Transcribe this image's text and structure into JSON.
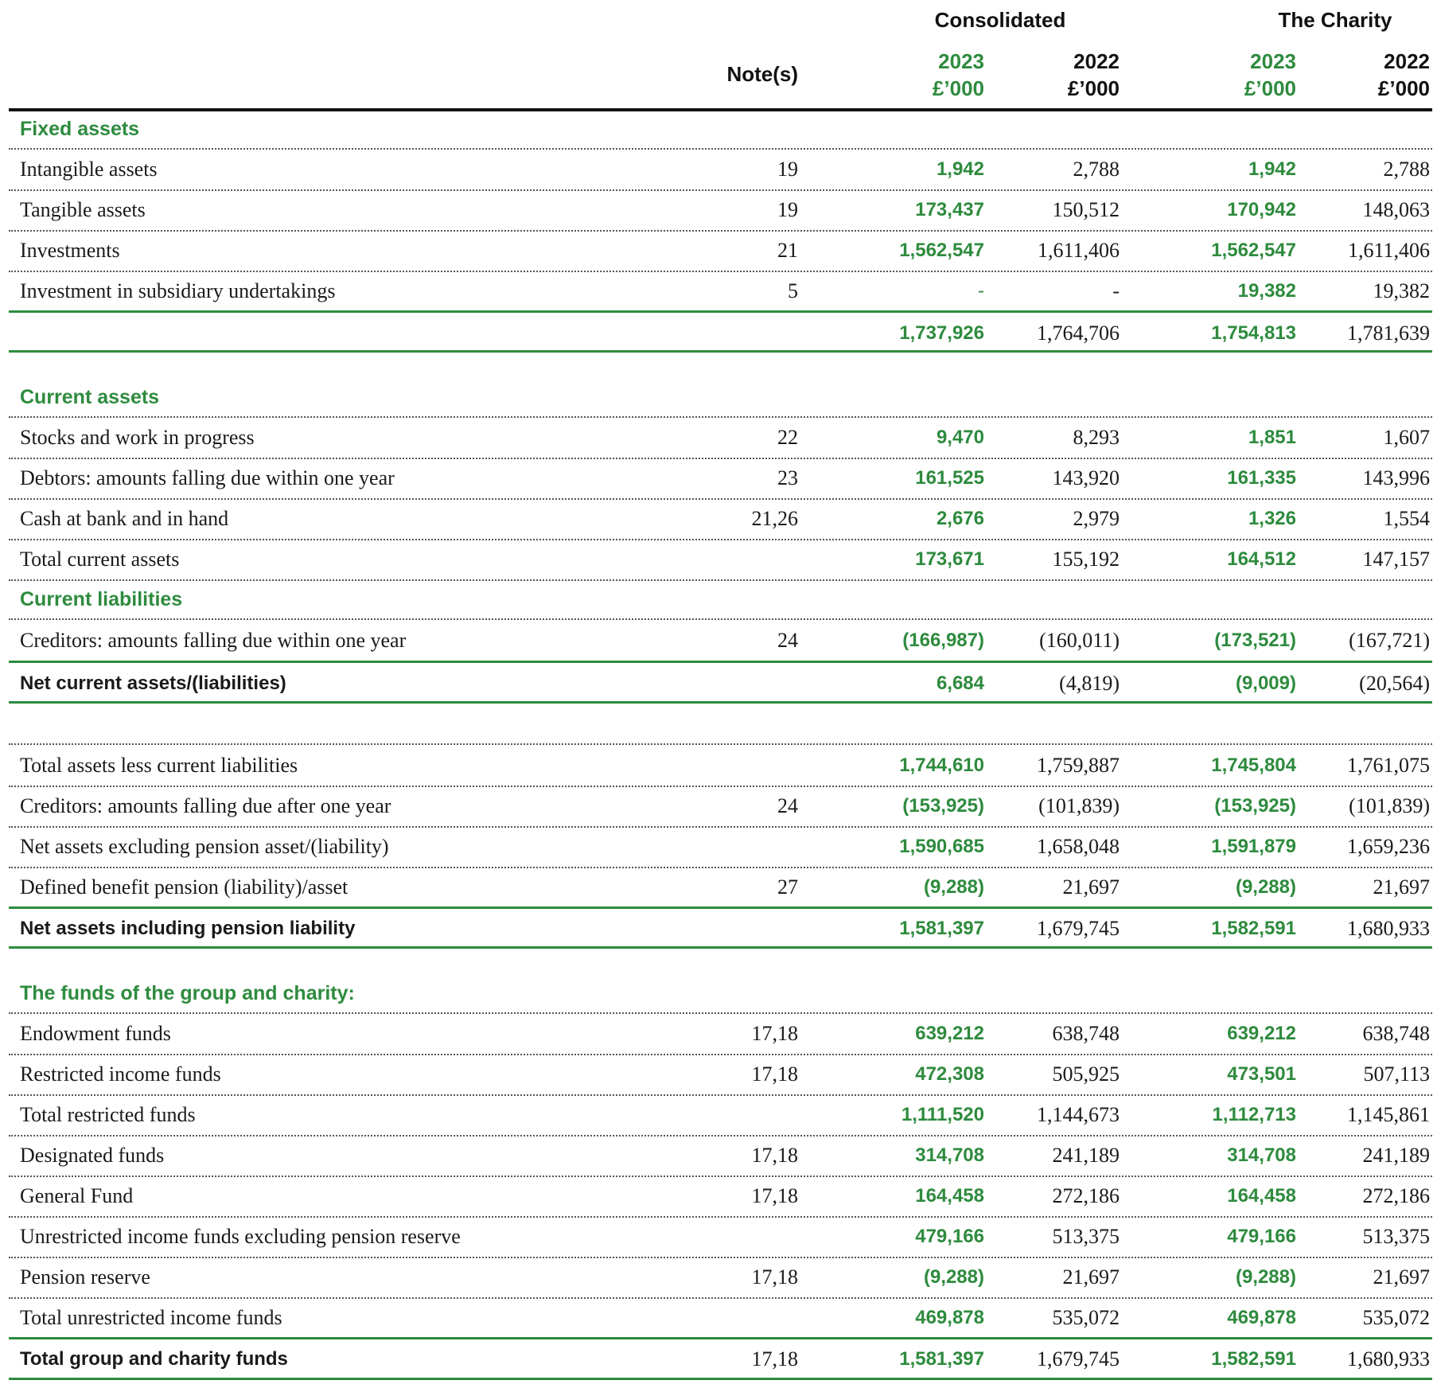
{
  "header": {
    "consolidated": "Consolidated",
    "charity": "The Charity",
    "note": "Note(s)",
    "y2023": "2023",
    "y2022": "2022",
    "unit": "£’000"
  },
  "sections": {
    "fixed_assets": "Fixed assets",
    "current_assets": "Current assets",
    "current_liabilities": "Current liabilities",
    "funds": "The funds of the group and charity:"
  },
  "rows": {
    "intangible": {
      "label": "Intangible assets",
      "note": "19",
      "c1": "1,942",
      "c2": "2,788",
      "c3": "1,942",
      "c4": "2,788"
    },
    "tangible": {
      "label": "Tangible assets",
      "note": "19",
      "c1": "173,437",
      "c2": "150,512",
      "c3": "170,942",
      "c4": "148,063"
    },
    "investments": {
      "label": "Investments",
      "note": "21",
      "c1": "1,562,547",
      "c2": "1,611,406",
      "c3": "1,562,547",
      "c4": "1,611,406"
    },
    "subsidiary": {
      "label": "Investment in subsidiary undertakings",
      "note": "5",
      "c1": "-",
      "c2": "-",
      "c3": "19,382",
      "c4": "19,382"
    },
    "fixed_total": {
      "label": "",
      "note": "",
      "c1": "1,737,926",
      "c2": "1,764,706",
      "c3": "1,754,813",
      "c4": "1,781,639"
    },
    "stocks": {
      "label": "Stocks and work in progress",
      "note": "22",
      "c1": "9,470",
      "c2": "8,293",
      "c3": "1,851",
      "c4": "1,607"
    },
    "debtors": {
      "label": "Debtors: amounts falling due within one year",
      "note": "23",
      "c1": "161,525",
      "c2": "143,920",
      "c3": "161,335",
      "c4": "143,996"
    },
    "cash": {
      "label": "Cash at bank and in hand",
      "note": "21,26",
      "c1": "2,676",
      "c2": "2,979",
      "c3": "1,326",
      "c4": "1,554"
    },
    "total_current": {
      "label": "Total current assets",
      "note": "",
      "c1": "173,671",
      "c2": "155,192",
      "c3": "164,512",
      "c4": "147,157"
    },
    "creditors_within": {
      "label": "Creditors: amounts falling due within one year",
      "note": "24",
      "c1": "(166,987)",
      "c2": "(160,011)",
      "c3": "(173,521)",
      "c4": "(167,721)"
    },
    "net_current": {
      "label": "Net current assets/(liabilities)",
      "note": "",
      "c1": "6,684",
      "c2": "(4,819)",
      "c3": "(9,009)",
      "c4": "(20,564)"
    },
    "total_less_cl": {
      "label": "Total assets less current liabilities",
      "note": "",
      "c1": "1,744,610",
      "c2": "1,759,887",
      "c3": "1,745,804",
      "c4": "1,761,075"
    },
    "creditors_after": {
      "label": "Creditors: amounts falling due after one year",
      "note": "24",
      "c1": "(153,925)",
      "c2": "(101,839)",
      "c3": "(153,925)",
      "c4": "(101,839)"
    },
    "net_excl_pension": {
      "label": "Net assets excluding pension asset/(liability)",
      "note": "",
      "c1": "1,590,685",
      "c2": "1,658,048",
      "c3": "1,591,879",
      "c4": "1,659,236"
    },
    "defined_benefit": {
      "label": "Defined benefit pension (liability)/asset",
      "note": "27",
      "c1": "(9,288)",
      "c2": "21,697",
      "c3": "(9,288)",
      "c4": "21,697"
    },
    "net_incl_pension": {
      "label": "Net assets including pension liability",
      "note": "",
      "c1": "1,581,397",
      "c2": "1,679,745",
      "c3": "1,582,591",
      "c4": "1,680,933"
    },
    "endowment": {
      "label": "Endowment funds",
      "note": "17,18",
      "c1": "639,212",
      "c2": "638,748",
      "c3": "639,212",
      "c4": "638,748"
    },
    "restricted_income": {
      "label": "Restricted income funds",
      "note": "17,18",
      "c1": "472,308",
      "c2": "505,925",
      "c3": "473,501",
      "c4": "507,113"
    },
    "total_restricted": {
      "label": "Total restricted funds",
      "note": "",
      "c1": "1,111,520",
      "c2": "1,144,673",
      "c3": "1,112,713",
      "c4": "1,145,861"
    },
    "designated": {
      "label": "Designated funds",
      "note": "17,18",
      "c1": "314,708",
      "c2": "241,189",
      "c3": "314,708",
      "c4": "241,189"
    },
    "general": {
      "label": "General Fund",
      "note": "17,18",
      "c1": "164,458",
      "c2": "272,186",
      "c3": "164,458",
      "c4": "272,186"
    },
    "unrestricted_excl": {
      "label": "Unrestricted income funds excluding pension reserve",
      "note": "",
      "c1": "479,166",
      "c2": "513,375",
      "c3": "479,166",
      "c4": "513,375"
    },
    "pension_reserve": {
      "label": "Pension reserve",
      "note": "17,18",
      "c1": "(9,288)",
      "c2": "21,697",
      "c3": "(9,288)",
      "c4": "21,697"
    },
    "total_unrestricted": {
      "label": "Total unrestricted income funds",
      "note": "",
      "c1": "469,878",
      "c2": "535,072",
      "c3": "469,878",
      "c4": "535,072"
    },
    "total_funds": {
      "label": "Total group and charity funds",
      "note": "17,18",
      "c1": "1,581,397",
      "c2": "1,679,745",
      "c3": "1,582,591",
      "c4": "1,680,933"
    }
  },
  "colors": {
    "accent": "#2e8b3e",
    "text": "#1a1a1a"
  }
}
